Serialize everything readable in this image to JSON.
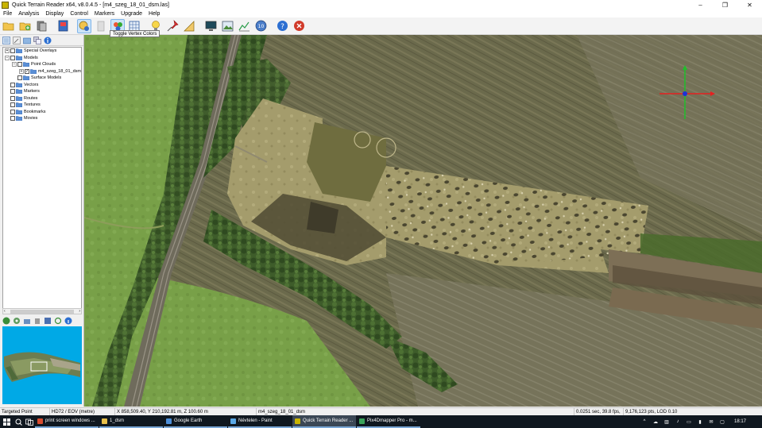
{
  "window": {
    "title": "Quick Terrain Reader x64, v8.0.4.5 - [m4_szeg_18_01_dsm.las]",
    "minimize": "–",
    "maximize": "❐",
    "close": "✕"
  },
  "menu": [
    "File",
    "Analysis",
    "Display",
    "Control",
    "Markers",
    "Upgrade",
    "Help"
  ],
  "toolbar": {
    "tooltip": "Toggle Vertex Colors"
  },
  "tree": {
    "items": [
      {
        "label": "Special Overlays",
        "indent": 0,
        "expander": "+",
        "check": false
      },
      {
        "label": "Models",
        "indent": 0,
        "expander": "−",
        "check": false
      },
      {
        "label": "Point Clouds",
        "indent": 1,
        "expander": "−",
        "check": false
      },
      {
        "label": "m4_szeg_18_01_dsm",
        "indent": 2,
        "expander": "+",
        "check": true
      },
      {
        "label": "Surface Models",
        "indent": 1,
        "expander": "",
        "check": false
      },
      {
        "label": "Vectors",
        "indent": 0,
        "expander": "",
        "check": false
      },
      {
        "label": "Markers",
        "indent": 0,
        "expander": "",
        "check": false
      },
      {
        "label": "Routes",
        "indent": 0,
        "expander": "",
        "check": false
      },
      {
        "label": "Textures",
        "indent": 0,
        "expander": "",
        "check": false
      },
      {
        "label": "Bookmarks",
        "indent": 0,
        "expander": "",
        "check": false
      },
      {
        "label": "Movies",
        "indent": 0,
        "expander": "",
        "check": false
      }
    ],
    "scroll_left": "‹",
    "scroll_right": "›"
  },
  "status": {
    "mode": "Targeted Point",
    "datum": "HD72 / EOV (metre)",
    "coords": "X 858,509.40, Y 210,192.81 m, Z 100.60 m",
    "file": "m4_szeg_18_01_dsm",
    "timing": "0.0251 sec, 39.8 fps,",
    "points": "9,176,123 pts, LOD 0.10"
  },
  "taskbar": {
    "apps": [
      {
        "label": "print screen windows ...",
        "color": "#d94c2f",
        "active": false
      },
      {
        "label": "1_dsm",
        "color": "#e8c04a",
        "active": false
      },
      {
        "label": "Google Earth",
        "color": "#4d8fd9",
        "active": false
      },
      {
        "label": "Névtelen - Paint",
        "color": "#5aa8e6",
        "active": false
      },
      {
        "label": "Quick Terrain Reader ...",
        "color": "#c8b400",
        "active": true
      },
      {
        "label": "Pix4Dmapper Pro - m...",
        "color": "#3aa35a",
        "active": false
      }
    ],
    "clock": "18:17",
    "lang": "^"
  },
  "colors": {
    "field": "#6b6a4a",
    "grass": "#7da04b",
    "forest": "#3f5e2a",
    "rail": "#6e6a60",
    "site": "#a39b6b",
    "minimap_bg": "#00a9e6"
  }
}
